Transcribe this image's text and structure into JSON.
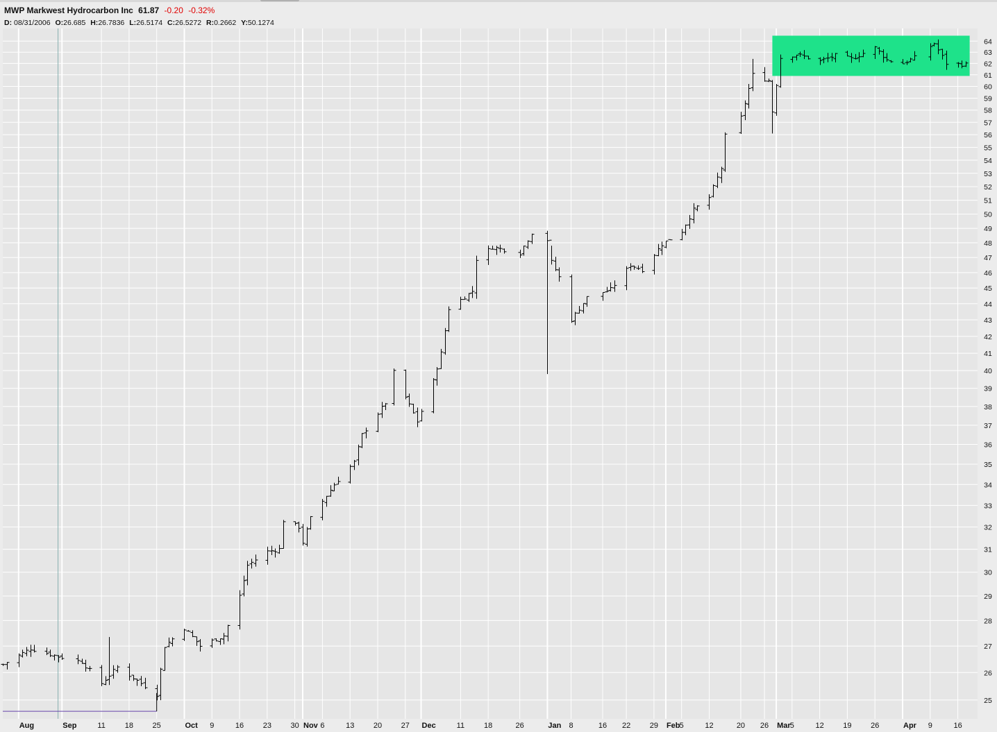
{
  "header": {
    "symbol": "MWP",
    "name": "Markwest Hydrocarbon Inc",
    "last": "61.87",
    "change": "-0.20",
    "change_pct": "-0.32%"
  },
  "ohlc_readout": {
    "d_label": "D:",
    "d": "08/31/2006",
    "o_label": "O:",
    "o": "26.685",
    "h_label": "H:",
    "h": "26.7836",
    "l_label": "L:",
    "l": "26.5174",
    "c_label": "C:",
    "c": "26.5272",
    "r_label": "R:",
    "r": "0.2662",
    "y_label": "Y:",
    "y": "50.1274"
  },
  "colors": {
    "background": "#e6e6e6",
    "grid": "#ffffff",
    "bars": "#000000",
    "highlight": "#1ee28a",
    "change": "#e00000",
    "baseline": "#6644aa",
    "cursor": "#88b0b0"
  },
  "chart_data": {
    "type": "ohlc-bar",
    "title": "MWP Markwest Hydrocarbon Inc",
    "y_axis": {
      "position": "right",
      "range": [
        24.8,
        64.4
      ],
      "ticks": [
        25,
        26,
        27,
        28,
        29,
        30,
        31,
        32,
        33,
        34,
        35,
        36,
        37,
        38,
        39,
        40,
        41,
        42,
        43,
        44,
        45,
        46,
        47,
        48,
        49,
        50,
        51,
        52,
        53,
        54,
        55,
        56,
        57,
        58,
        59,
        60,
        61,
        62,
        63,
        64
      ]
    },
    "x_axis": {
      "range": [
        "2006-08-17",
        "2007-04-21"
      ],
      "ticks": [
        {
          "date": "2006-08-21",
          "label": "Aug",
          "bold": true
        },
        {
          "date": "2006-09-01",
          "label": "Sep",
          "bold": true
        },
        {
          "date": "2006-09-11",
          "label": "11"
        },
        {
          "date": "2006-09-18",
          "label": "18"
        },
        {
          "date": "2006-09-25",
          "label": "25"
        },
        {
          "date": "2006-10-02",
          "label": "Oct",
          "bold": true
        },
        {
          "date": "2006-10-09",
          "label": "9"
        },
        {
          "date": "2006-10-16",
          "label": "16"
        },
        {
          "date": "2006-10-23",
          "label": "23"
        },
        {
          "date": "2006-10-30",
          "label": "30"
        },
        {
          "date": "2006-11-01",
          "label": "Nov",
          "bold": true
        },
        {
          "date": "2006-11-06",
          "label": "6"
        },
        {
          "date": "2006-11-13",
          "label": "13"
        },
        {
          "date": "2006-11-20",
          "label": "20"
        },
        {
          "date": "2006-11-27",
          "label": "27"
        },
        {
          "date": "2006-12-01",
          "label": "Dec",
          "bold": true
        },
        {
          "date": "2006-12-11",
          "label": "11"
        },
        {
          "date": "2006-12-18",
          "label": "18"
        },
        {
          "date": "2006-12-26",
          "label": "26"
        },
        {
          "date": "2007-01-02",
          "label": "Jan",
          "bold": true
        },
        {
          "date": "2007-01-08",
          "label": "8"
        },
        {
          "date": "2007-01-16",
          "label": "16"
        },
        {
          "date": "2007-01-22",
          "label": "22"
        },
        {
          "date": "2007-01-29",
          "label": "29"
        },
        {
          "date": "2007-02-01",
          "label": "Feb",
          "bold": true
        },
        {
          "date": "2007-02-05",
          "label": "5"
        },
        {
          "date": "2007-02-12",
          "label": "12"
        },
        {
          "date": "2007-02-20",
          "label": "20"
        },
        {
          "date": "2007-02-26",
          "label": "26"
        },
        {
          "date": "2007-03-01",
          "label": "Mar",
          "bold": true
        },
        {
          "date": "2007-03-05",
          "label": "5"
        },
        {
          "date": "2007-03-12",
          "label": "12"
        },
        {
          "date": "2007-03-19",
          "label": "19"
        },
        {
          "date": "2007-03-26",
          "label": "26"
        },
        {
          "date": "2007-04-02",
          "label": "Apr",
          "bold": true
        },
        {
          "date": "2007-04-09",
          "label": "9"
        },
        {
          "date": "2007-04-16",
          "label": "16"
        }
      ]
    },
    "crosshair_date": "2006-08-31",
    "baseline": {
      "start": "2006-08-17",
      "end": "2006-09-25",
      "value": 24.6
    },
    "highlight_zone": {
      "start": "2007-02-28",
      "end": "2007-04-19",
      "low": 60.9,
      "high": 64.5
    },
    "anchors": [
      {
        "date": "2006-08-17",
        "close": 26.3
      },
      {
        "date": "2006-08-24",
        "close": 26.9
      },
      {
        "date": "2006-08-31",
        "close": 26.6
      },
      {
        "date": "2006-09-06",
        "close": 26.4
      },
      {
        "date": "2006-09-11",
        "close": 25.6
      },
      {
        "date": "2006-09-15",
        "close": 26.2
      },
      {
        "date": "2006-09-25",
        "close": 25.2
      },
      {
        "date": "2006-09-27",
        "close": 27.0
      },
      {
        "date": "2006-10-02",
        "close": 27.7
      },
      {
        "date": "2006-10-06",
        "close": 27.0
      },
      {
        "date": "2006-10-12",
        "close": 27.4
      },
      {
        "date": "2006-10-13",
        "close": 27.8
      },
      {
        "date": "2006-10-16",
        "close": 29.0
      },
      {
        "date": "2006-10-18",
        "close": 30.3
      },
      {
        "date": "2006-10-23",
        "close": 30.9
      },
      {
        "date": "2006-10-26",
        "close": 31.0
      },
      {
        "date": "2006-10-27",
        "close": 32.3
      },
      {
        "date": "2006-10-31",
        "close": 32.0
      },
      {
        "date": "2006-11-01",
        "close": 31.3
      },
      {
        "date": "2006-11-03",
        "close": 32.4
      },
      {
        "date": "2006-11-09",
        "close": 34.0
      },
      {
        "date": "2006-11-14",
        "close": 35.1
      },
      {
        "date": "2006-11-16",
        "close": 36.5
      },
      {
        "date": "2006-11-22",
        "close": 38.2
      },
      {
        "date": "2006-11-24",
        "close": 39.9
      },
      {
        "date": "2006-11-27",
        "close": 38.5
      },
      {
        "date": "2006-11-30",
        "close": 37.2
      },
      {
        "date": "2006-12-04",
        "close": 39.4
      },
      {
        "date": "2006-12-06",
        "close": 41.0
      },
      {
        "date": "2006-12-08",
        "close": 43.7
      },
      {
        "date": "2006-12-14",
        "close": 44.8
      },
      {
        "date": "2006-12-15",
        "close": 46.9
      },
      {
        "date": "2006-12-19",
        "close": 47.7
      },
      {
        "date": "2006-12-26",
        "close": 47.3
      },
      {
        "date": "2006-12-29",
        "close": 48.7
      },
      {
        "date": "2007-01-02",
        "close": 48.2
      },
      {
        "date": "2007-01-03",
        "close": 46.7
      },
      {
        "date": "2007-01-05",
        "close": 45.7
      },
      {
        "date": "2007-01-08",
        "close": 43.0
      },
      {
        "date": "2007-01-12",
        "close": 44.4
      },
      {
        "date": "2007-01-18",
        "close": 44.9
      },
      {
        "date": "2007-01-23",
        "close": 46.5
      },
      {
        "date": "2007-01-26",
        "close": 46.2
      },
      {
        "date": "2007-01-31",
        "close": 47.9
      },
      {
        "date": "2007-02-05",
        "close": 48.8
      },
      {
        "date": "2007-02-08",
        "close": 50.3
      },
      {
        "date": "2007-02-12",
        "close": 51.2
      },
      {
        "date": "2007-02-15",
        "close": 53.4
      },
      {
        "date": "2007-02-16",
        "close": 55.9
      },
      {
        "date": "2007-02-20",
        "close": 57.4
      },
      {
        "date": "2007-02-23",
        "close": 61.0
      },
      {
        "date": "2007-02-27",
        "close": 60.5
      },
      {
        "date": "2007-02-28",
        "close": 57.9
      },
      {
        "date": "2007-03-02",
        "close": 62.5
      },
      {
        "date": "2007-03-06",
        "close": 62.8
      },
      {
        "date": "2007-03-12",
        "close": 62.2
      },
      {
        "date": "2007-03-16",
        "close": 62.7
      },
      {
        "date": "2007-03-20",
        "close": 62.4
      },
      {
        "date": "2007-03-26",
        "close": 63.4
      },
      {
        "date": "2007-03-29",
        "close": 62.3
      },
      {
        "date": "2007-04-02",
        "close": 62.0
      },
      {
        "date": "2007-04-05",
        "close": 62.5
      },
      {
        "date": "2007-04-10",
        "close": 63.8
      },
      {
        "date": "2007-04-13",
        "close": 62.0
      },
      {
        "date": "2007-04-18",
        "close": 61.9
      }
    ],
    "spikes": [
      {
        "date": "2006-09-13",
        "high": 27.35
      },
      {
        "date": "2007-01-02",
        "low": 39.8
      },
      {
        "date": "2007-01-03",
        "high": 47.8
      },
      {
        "date": "2007-02-23",
        "high": 62.4
      },
      {
        "date": "2007-02-28",
        "low": 56.1
      }
    ]
  }
}
